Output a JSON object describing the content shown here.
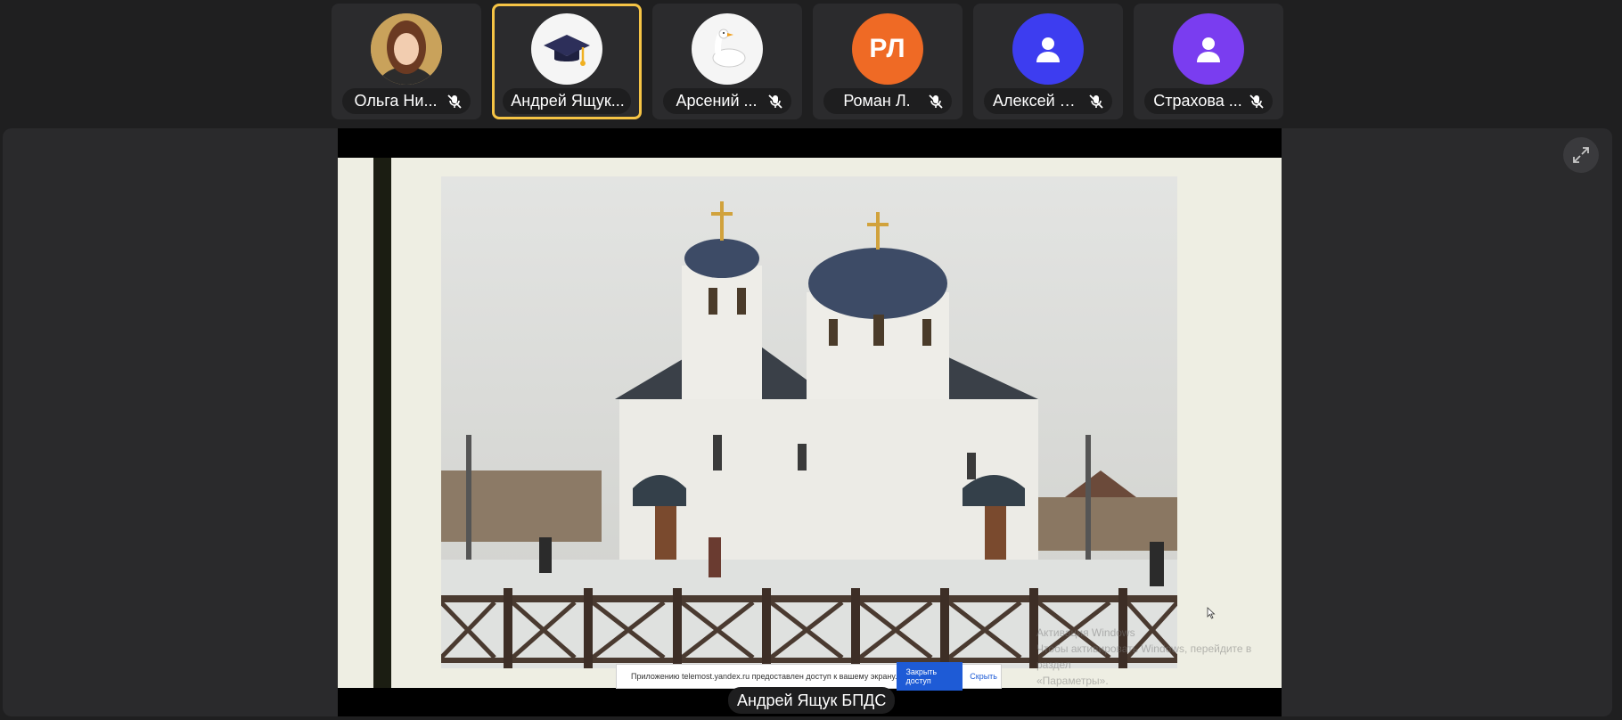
{
  "participants": [
    {
      "name": "Ольга Ни...",
      "avatar": "photo-woman",
      "muted": true
    },
    {
      "name": "Андрей Ящук...",
      "avatar": "graduation-cap-emoji",
      "muted": false,
      "active": true,
      "active_color": "#f6c445"
    },
    {
      "name": "Арсений ...",
      "avatar": "goose-emoji",
      "muted": true
    },
    {
      "name": "Роман Л.",
      "avatar": "initials",
      "initials": "РЛ",
      "color": "#ef6a25",
      "muted": true
    },
    {
      "name": "Алексей Ф...",
      "avatar": "person-icon",
      "color": "#3d3df0",
      "muted": true
    },
    {
      "name": "Страхова ...",
      "avatar": "person-icon",
      "color": "#7a3df0",
      "muted": true
    }
  ],
  "stage": {
    "presenter_label": "Андрей Ящук БПДС",
    "screen_share": {
      "content": "church-photo-slide",
      "watermark_line1": "Активация Windows",
      "watermark_line2": "Чтобы активировать Windows, перейдите в раздел",
      "watermark_line3": "«Параметры»."
    },
    "notification": {
      "text": "Приложению telemost.yandex.ru предоставлен доступ к вашему экрану.",
      "stop_button": "Закрыть доступ",
      "hide_link": "Скрыть"
    }
  },
  "colors": {
    "background": "#1f1f20",
    "tile": "#2b2b2d",
    "accent_blue": "#1e5bd6"
  }
}
